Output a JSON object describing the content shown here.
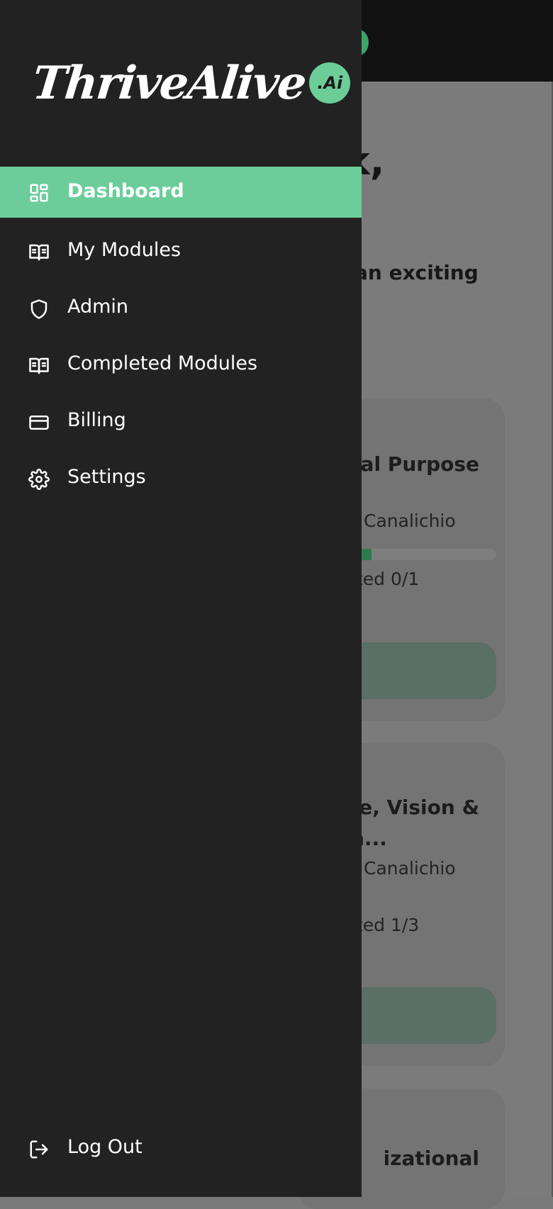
{
  "colors": {
    "accent": "#6ccd9b",
    "sidebar_bg": "#222222",
    "overlay_bg": "#7a7a7a",
    "topbar_bg": "#111111"
  },
  "brand": {
    "logo_text": "ThriveAlive",
    "logo_badge": ".Ai"
  },
  "sidebar": {
    "items": [
      {
        "label": "Dashboard",
        "icon": "dashboard-grid-icon",
        "active": true
      },
      {
        "label": "My Modules",
        "icon": "open-book-icon",
        "active": false
      },
      {
        "label": "Admin",
        "icon": "shield-icon",
        "active": false
      },
      {
        "label": "Completed Modules",
        "icon": "open-book-icon",
        "active": false
      },
      {
        "label": "Billing",
        "icon": "credit-card-icon",
        "active": false
      },
      {
        "label": "Settings",
        "icon": "gear-icon",
        "active": false
      }
    ],
    "logout": {
      "label": "Log Out",
      "icon": "logout-icon"
    }
  },
  "background": {
    "heading_fragment": "k,",
    "subtitle_fragment": "an exciting",
    "cards": [
      {
        "title_fragment": "nal Purpose",
        "author_fragment": "Canalichio",
        "completed_fragment": "ted 0/1",
        "progress": 0.2
      },
      {
        "title_fragment_line1": "se, Vision &",
        "title_fragment_line2": "n...",
        "author_fragment": "Canalichio",
        "completed_fragment": "ted 1/3"
      },
      {
        "title_fragment": "izational"
      }
    ]
  }
}
